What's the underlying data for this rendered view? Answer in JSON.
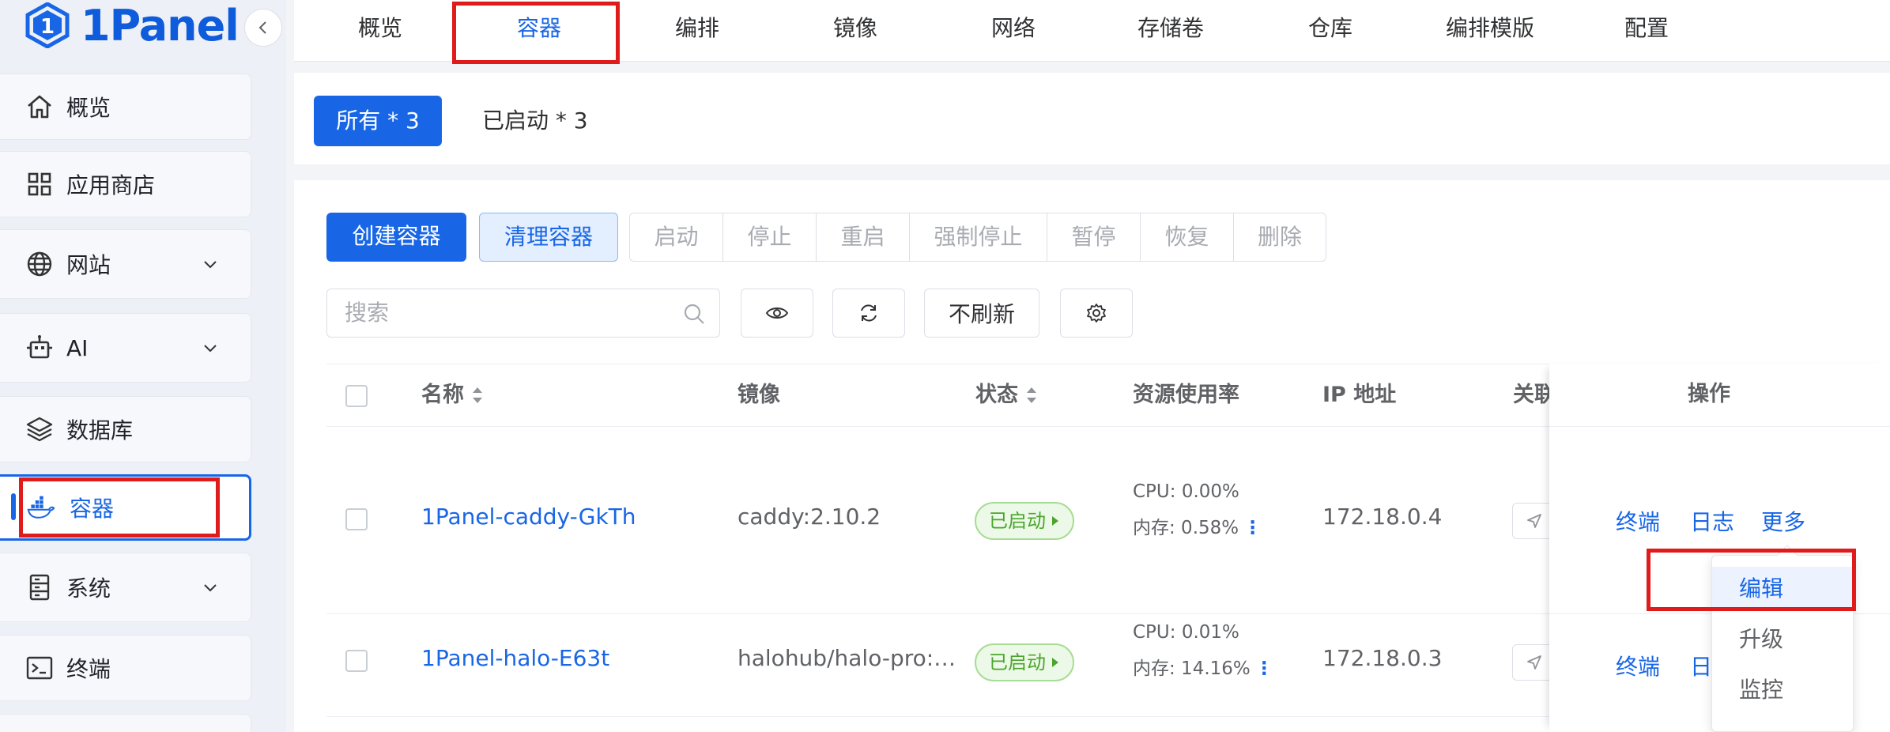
{
  "brand": {
    "name": "1Panel",
    "color": "#1866e6"
  },
  "sidebar": {
    "items": [
      {
        "label": "概览",
        "icon": "home-icon"
      },
      {
        "label": "应用商店",
        "icon": "grid-icon"
      },
      {
        "label": "网站",
        "icon": "globe-icon",
        "expandable": true
      },
      {
        "label": "AI",
        "icon": "robot-icon",
        "expandable": true
      },
      {
        "label": "数据库",
        "icon": "layers-icon"
      },
      {
        "label": "容器",
        "icon": "docker-icon",
        "active": true
      },
      {
        "label": "系统",
        "icon": "server-icon",
        "expandable": true
      },
      {
        "label": "终端",
        "icon": "terminal-icon"
      }
    ]
  },
  "top_tabs": [
    "概览",
    "容器",
    "编排",
    "镜像",
    "网络",
    "存储卷",
    "仓库",
    "编排模版",
    "配置"
  ],
  "active_top_tab": "容器",
  "filter": {
    "all": "所有 * 3",
    "running": "已启动 * 3"
  },
  "toolbar": {
    "create": "创建容器",
    "clean": "清理容器",
    "group": [
      "启动",
      "停止",
      "重启",
      "强制停止",
      "暂停",
      "恢复",
      "删除"
    ],
    "search_placeholder": "搜索",
    "no_refresh": "不刷新"
  },
  "table": {
    "headers": {
      "name": "名称",
      "image": "镜像",
      "status": "状态",
      "resource": "资源使用率",
      "ip": "IP 地址",
      "link": "关联",
      "actions": "操作"
    },
    "rows": [
      {
        "name": "1Panel-caddy-GkTh",
        "image": "caddy:2.10.2",
        "status": "已启动",
        "cpu": "CPU: 0.00%",
        "mem": "内存: 0.58%",
        "ip": "172.18.0.4",
        "actions": [
          "终端",
          "日志",
          "更多"
        ]
      },
      {
        "name": "1Panel-halo-E63t",
        "image": "halohub/halo-pro:…",
        "status": "已启动",
        "cpu": "CPU: 0.01%",
        "mem": "内存: 14.16%",
        "ip": "172.18.0.3",
        "actions": [
          "终端",
          "日"
        ]
      }
    ]
  },
  "more_menu": [
    "编辑",
    "升级",
    "监控"
  ]
}
